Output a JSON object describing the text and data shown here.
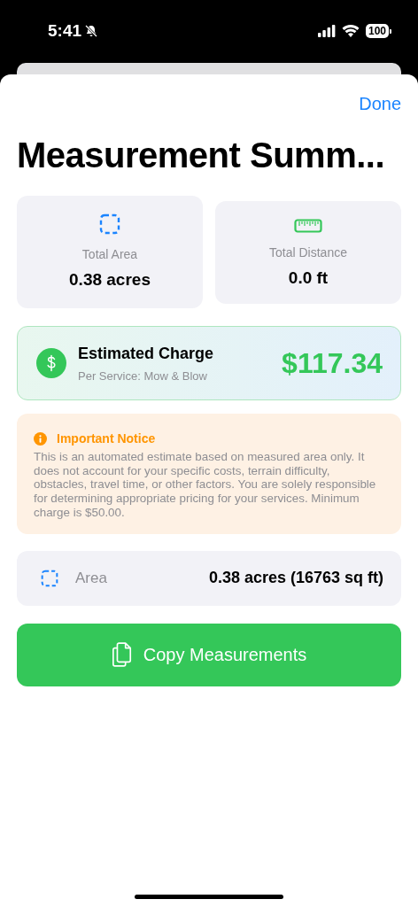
{
  "status_bar": {
    "time": "5:41",
    "silent": true,
    "battery": "100"
  },
  "sheet": {
    "done": "Done",
    "title": "Measurement Summ..."
  },
  "stats": [
    {
      "kind": "area",
      "label": "Total Area",
      "value": "0.38 acres"
    },
    {
      "kind": "distance",
      "label": "Total Distance",
      "value": "0.0 ft"
    }
  ],
  "charge": {
    "title": "Estimated Charge",
    "subtitle": "Per Service: Mow & Blow",
    "amount": "$117.34"
  },
  "notice": {
    "title": "Important Notice",
    "body": "This is an automated estimate based on measured area only. It does not account for your specific costs, terrain difficulty, obstacles, travel time, or other factors. You are solely responsible for determining appropriate pricing for your services. Minimum charge is $50.00."
  },
  "rows": [
    {
      "kind": "area",
      "label": "Area",
      "value": "0.38 acres (16763 sq ft)"
    }
  ],
  "copy_button": "Copy Measurements"
}
